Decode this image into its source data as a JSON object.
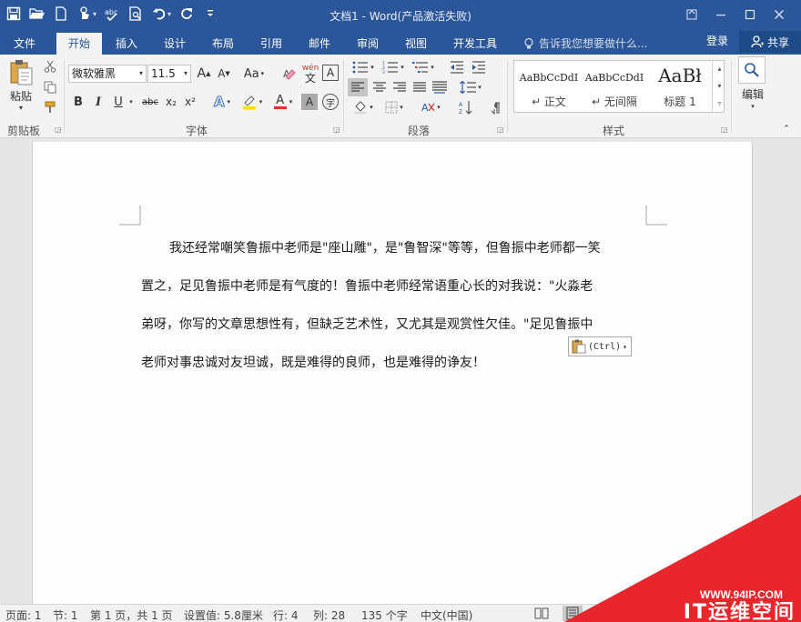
{
  "window": {
    "title": "文档1 - Word(产品激活失败)",
    "controls": [
      "restore-ribbon",
      "minimize",
      "maximize",
      "close"
    ]
  },
  "quick_access": {
    "items": [
      "save-icon",
      "open-icon",
      "new-icon",
      "touch-mode-icon",
      "spelling-icon",
      "print-preview-icon",
      "undo-icon",
      "redo-icon",
      "customize-icon"
    ]
  },
  "ribbon_tabs": [
    {
      "label": "文件",
      "active": false
    },
    {
      "label": "开始",
      "active": true
    },
    {
      "label": "插入",
      "active": false
    },
    {
      "label": "设计",
      "active": false
    },
    {
      "label": "布局",
      "active": false
    },
    {
      "label": "引用",
      "active": false
    },
    {
      "label": "邮件",
      "active": false
    },
    {
      "label": "审阅",
      "active": false
    },
    {
      "label": "视图",
      "active": false
    },
    {
      "label": "开发工具",
      "active": false
    }
  ],
  "tell_me": "告诉我您想要做什么...",
  "account": {
    "login": "登录",
    "share": "共享"
  },
  "clipboard": {
    "paste": "粘贴",
    "group": "剪贴板"
  },
  "font": {
    "name": "微软雅黑",
    "size": "11.5",
    "grow": "A",
    "shrink": "A",
    "case": "Aa",
    "pinyin_top": "wén",
    "pinyin_bottom": "文",
    "border_char": "A",
    "bold": "B",
    "italic": "I",
    "underline": "U",
    "strike": "abc",
    "subscript": "x₂",
    "superscript": "x²",
    "effects": "A",
    "color": "A",
    "shade": "A",
    "enclose": "字",
    "group": "字体"
  },
  "paragraph": {
    "group": "段落"
  },
  "styles": {
    "items": [
      {
        "preview": "AaBbCcDdI",
        "name": "↵ 正文"
      },
      {
        "preview": "AaBbCcDdI",
        "name": "↵ 无间隔"
      },
      {
        "preview": "AaBł",
        "name": "标题 1"
      }
    ],
    "group": "样式"
  },
  "editing": {
    "label": "编辑"
  },
  "document": {
    "lines": [
      "我还经常嘲笑鲁振中老师是\"座山雕\"，是\"鲁智深\"等等，但鲁振中老师都一笑",
      "置之，足见鲁振中老师是有气度的！鲁振中老师经常语重心长的对我说：\"火淼老",
      "弟呀，你写的文章思想性有，但缺乏艺术性，又尤其是观赏性欠佳。\"足见鲁振中",
      "老师对事忠诚对友坦诚，既是难得的良师，也是难得的诤友！"
    ],
    "paste_options": "(Ctrl)"
  },
  "status": {
    "page": "页面: 1",
    "section": "节: 1",
    "page_of": "第 1 页，共 1 页",
    "position": "设置值: 5.8厘米",
    "row": "行: 4",
    "col": "列: 28",
    "words": "135 个字",
    "language": "中文(中国)"
  },
  "watermark": {
    "url": "WWW.94IP.COM",
    "brand": "IT运维空间"
  },
  "colors": {
    "accent": "#2b579a",
    "watermark_red": "#e8262b"
  }
}
